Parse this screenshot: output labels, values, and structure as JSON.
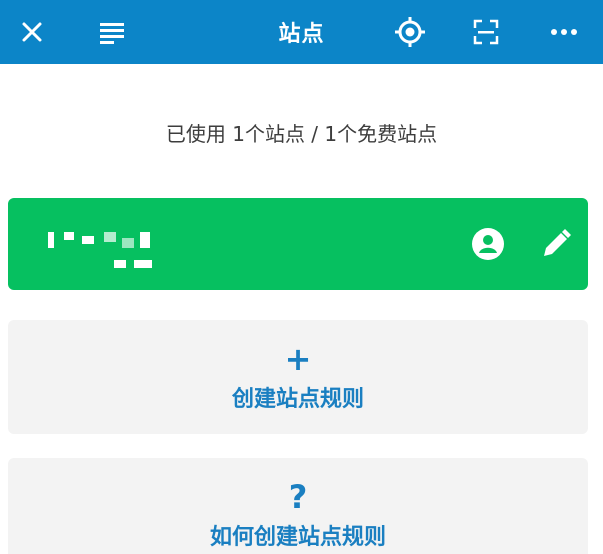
{
  "header": {
    "title": "站点",
    "icons": {
      "close": "close-icon",
      "menu": "menu-lines-icon",
      "locate": "locate-target-icon",
      "scan": "scan-frame-icon",
      "more": "more-dots-icon"
    },
    "background_color": "#0c85c8"
  },
  "usage_text": "已使用 1个站点 / 1个免费站点",
  "site_card": {
    "name_obscured": true,
    "background_color": "#06c060",
    "icons": {
      "account": "account-circle-icon",
      "edit": "edit-pencil-icon"
    }
  },
  "actions": [
    {
      "symbol": "+",
      "label": "创建站点规则",
      "icon": "plus-icon"
    },
    {
      "symbol": "?",
      "label": "如何创建站点规则",
      "icon": "question-icon"
    }
  ],
  "accent_color": "#1a7fc1"
}
